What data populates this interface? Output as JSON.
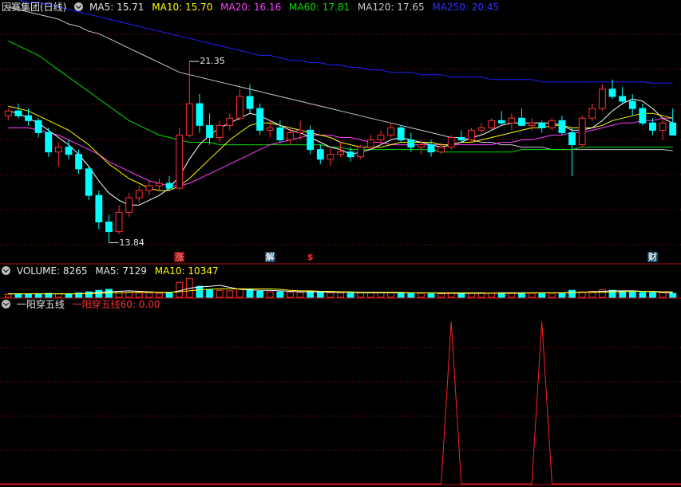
{
  "colors": {
    "background": "#000000",
    "grid": "#7a1010",
    "up": "#ff3030",
    "down": "#00ffff",
    "ma5": "#ffffff",
    "ma10": "#ffff00",
    "ma20": "#ff40ff",
    "ma60": "#00e000",
    "ma120": "#c8c8c8",
    "ma250": "#2020ff",
    "signal": "#ff2020"
  },
  "main_panel": {
    "stock": "因赛集团(日线)",
    "ma5": "MA5: 15.71",
    "ma10": "MA10: 15.70",
    "ma20": "MA20: 16.16",
    "ma60": "MA60: 17.81",
    "ma120": "MA120: 17.65",
    "ma250": "MA250: 20.45",
    "high_label": "21.35",
    "low_label": "13.84"
  },
  "volume_panel": {
    "title": "VOLUME: 8265",
    "ma5": "MA5: 7129",
    "ma10": "MA10: 10347"
  },
  "indicator_panel": {
    "name": "一阳穿五线",
    "value": "一阳穿五线60: 0.00"
  },
  "events": [
    {
      "index": 17,
      "label": "涨",
      "kind": "up"
    },
    {
      "index": 26,
      "label": "解",
      "kind": "down"
    },
    {
      "index": 30,
      "label": "$",
      "kind": "dollar"
    },
    {
      "index": 64,
      "label": "财",
      "kind": "down"
    }
  ],
  "chart_data": {
    "type": "candlestick",
    "ylim": [
      13.0,
      23.3
    ],
    "candles": [
      [
        19.1,
        19.4,
        18.9,
        19.3
      ],
      [
        19.3,
        19.6,
        19.0,
        19.1
      ],
      [
        19.1,
        19.4,
        18.7,
        18.9
      ],
      [
        18.9,
        19.0,
        18.2,
        18.4
      ],
      [
        18.4,
        18.6,
        17.4,
        17.6
      ],
      [
        17.6,
        18.0,
        17.0,
        17.8
      ],
      [
        17.8,
        18.1,
        17.3,
        17.5
      ],
      [
        17.5,
        17.7,
        16.7,
        16.9
      ],
      [
        16.9,
        17.0,
        15.6,
        15.8
      ],
      [
        15.8,
        16.0,
        14.4,
        14.7
      ],
      [
        14.7,
        15.0,
        13.84,
        14.3
      ],
      [
        14.3,
        15.4,
        14.2,
        15.1
      ],
      [
        15.1,
        15.9,
        14.9,
        15.7
      ],
      [
        15.7,
        16.2,
        15.5,
        16.0
      ],
      [
        16.0,
        16.4,
        15.8,
        16.2
      ],
      [
        16.2,
        16.5,
        16.0,
        16.3
      ],
      [
        16.3,
        16.6,
        16.0,
        16.1
      ],
      [
        16.1,
        18.6,
        16.0,
        18.3
      ],
      [
        18.3,
        21.35,
        18.2,
        19.6
      ],
      [
        19.6,
        20.0,
        18.4,
        18.7
      ],
      [
        18.7,
        19.2,
        17.9,
        18.2
      ],
      [
        18.2,
        18.9,
        18.0,
        18.7
      ],
      [
        18.7,
        19.2,
        18.5,
        19.0
      ],
      [
        19.0,
        20.2,
        18.9,
        19.9
      ],
      [
        19.9,
        20.4,
        19.2,
        19.4
      ],
      [
        19.4,
        19.6,
        18.3,
        18.5
      ],
      [
        18.5,
        18.9,
        18.2,
        18.6
      ],
      [
        18.6,
        18.9,
        18.0,
        18.1
      ],
      [
        18.1,
        18.6,
        17.9,
        18.4
      ],
      [
        18.4,
        18.9,
        18.1,
        18.5
      ],
      [
        18.5,
        18.7,
        17.5,
        17.7
      ],
      [
        17.7,
        17.9,
        17.1,
        17.3
      ],
      [
        17.3,
        17.8,
        17.0,
        17.5
      ],
      [
        17.5,
        18.0,
        17.4,
        17.6
      ],
      [
        17.6,
        17.8,
        17.2,
        17.4
      ],
      [
        17.4,
        17.9,
        17.3,
        17.8
      ],
      [
        17.8,
        18.3,
        17.7,
        18.1
      ],
      [
        18.1,
        18.5,
        17.9,
        18.3
      ],
      [
        18.3,
        18.8,
        18.2,
        18.6
      ],
      [
        18.6,
        18.7,
        18.0,
        18.1
      ],
      [
        18.1,
        18.4,
        17.6,
        17.8
      ],
      [
        17.8,
        18.1,
        17.5,
        17.9
      ],
      [
        17.9,
        18.1,
        17.4,
        17.6
      ],
      [
        17.6,
        18.0,
        17.5,
        17.8
      ],
      [
        17.8,
        18.3,
        17.7,
        18.2
      ],
      [
        18.2,
        18.5,
        18.0,
        18.1
      ],
      [
        18.1,
        18.6,
        18.0,
        18.5
      ],
      [
        18.5,
        18.8,
        18.3,
        18.6
      ],
      [
        18.6,
        19.0,
        18.5,
        18.9
      ],
      [
        18.9,
        19.3,
        18.7,
        18.8
      ],
      [
        18.8,
        19.2,
        18.5,
        19.0
      ],
      [
        19.0,
        19.4,
        18.9,
        18.7
      ],
      [
        18.7,
        19.0,
        18.5,
        18.8
      ],
      [
        18.8,
        18.9,
        18.4,
        18.6
      ],
      [
        18.6,
        19.0,
        18.5,
        18.9
      ],
      [
        18.9,
        19.1,
        18.3,
        18.4
      ],
      [
        18.4,
        18.6,
        16.6,
        17.9
      ],
      [
        17.9,
        19.1,
        17.8,
        19.0
      ],
      [
        19.0,
        19.6,
        18.9,
        19.4
      ],
      [
        19.4,
        20.4,
        19.3,
        20.2
      ],
      [
        20.2,
        20.6,
        19.8,
        19.9
      ],
      [
        19.9,
        20.3,
        19.6,
        19.7
      ],
      [
        19.7,
        20.0,
        19.1,
        19.4
      ],
      [
        19.4,
        19.6,
        18.7,
        18.8
      ],
      [
        18.8,
        19.0,
        18.3,
        18.5
      ],
      [
        18.5,
        19.0,
        18.1,
        18.8
      ],
      [
        18.8,
        19.4,
        18.5,
        18.3
      ]
    ],
    "ma5": [
      19.3,
      19.2,
      19.0,
      18.8,
      18.5,
      18.2,
      17.9,
      17.5,
      17.0,
      16.4,
      15.9,
      15.6,
      15.4,
      15.4,
      15.6,
      15.8,
      16.1,
      16.6,
      17.3,
      17.9,
      18.3,
      18.6,
      18.8,
      19.0,
      19.2,
      19.1,
      18.9,
      18.7,
      18.5,
      18.4,
      18.2,
      18.0,
      17.8,
      17.7,
      17.5,
      17.6,
      17.7,
      17.9,
      18.1,
      18.2,
      18.1,
      18.0,
      17.9,
      17.8,
      17.9,
      18.0,
      18.2,
      18.3,
      18.5,
      18.7,
      18.8,
      18.8,
      18.8,
      18.8,
      18.8,
      18.7,
      18.5,
      18.5,
      18.6,
      18.9,
      19.3,
      19.6,
      19.8,
      19.7,
      19.4,
      19.0,
      18.8
    ],
    "ma10": [
      19.5,
      19.4,
      19.3,
      19.1,
      18.9,
      18.7,
      18.5,
      18.2,
      17.9,
      17.5,
      17.1,
      16.8,
      16.5,
      16.3,
      16.1,
      16.0,
      16.0,
      16.2,
      16.5,
      16.9,
      17.3,
      17.7,
      18.1,
      18.4,
      18.7,
      18.8,
      18.8,
      18.7,
      18.6,
      18.5,
      18.4,
      18.3,
      18.2,
      18.0,
      17.9,
      17.8,
      17.8,
      17.8,
      17.9,
      18.0,
      18.0,
      18.0,
      18.0,
      17.9,
      17.9,
      18.0,
      18.0,
      18.1,
      18.2,
      18.3,
      18.4,
      18.5,
      18.6,
      18.6,
      18.7,
      18.7,
      18.6,
      18.6,
      18.6,
      18.7,
      18.9,
      19.0,
      19.1,
      19.2,
      19.2,
      19.1,
      19.0
    ],
    "ma20": [
      18.6,
      18.6,
      18.6,
      18.5,
      18.4,
      18.3,
      18.1,
      17.9,
      17.7,
      17.5,
      17.2,
      17.0,
      16.8,
      16.6,
      16.4,
      16.3,
      16.2,
      16.2,
      16.3,
      16.5,
      16.7,
      16.9,
      17.1,
      17.3,
      17.5,
      17.7,
      17.9,
      18.0,
      18.1,
      18.2,
      18.3,
      18.3,
      18.3,
      18.2,
      18.2,
      18.1,
      18.0,
      18.0,
      17.9,
      17.9,
      17.9,
      17.9,
      17.9,
      17.9,
      17.9,
      17.9,
      17.9,
      17.9,
      17.9,
      18.0,
      18.0,
      18.1,
      18.1,
      18.2,
      18.3,
      18.3,
      18.4,
      18.4,
      18.5,
      18.6,
      18.7,
      18.8,
      18.8,
      18.9,
      18.9,
      19.0,
      19.0
    ],
    "ma60": [
      22.2,
      22.0,
      21.8,
      21.6,
      21.3,
      21.0,
      20.7,
      20.4,
      20.1,
      19.8,
      19.5,
      19.2,
      18.9,
      18.7,
      18.5,
      18.3,
      18.2,
      18.1,
      18.0,
      18.0,
      18.0,
      17.9,
      17.9,
      17.9,
      17.9,
      17.9,
      17.9,
      17.9,
      17.9,
      17.9,
      17.9,
      17.9,
      17.8,
      17.8,
      17.7,
      17.7,
      17.7,
      17.7,
      17.7,
      17.7,
      17.7,
      17.7,
      17.7,
      17.6,
      17.6,
      17.6,
      17.6,
      17.6,
      17.6,
      17.6,
      17.6,
      17.7,
      17.7,
      17.7,
      17.7,
      17.7,
      17.7,
      17.8,
      17.8,
      17.8,
      17.8,
      17.8,
      17.8,
      17.8,
      17.8,
      17.8,
      17.8
    ],
    "ma120": [
      23.6,
      23.5,
      23.4,
      23.3,
      23.2,
      23.1,
      22.9,
      22.8,
      22.6,
      22.5,
      22.3,
      22.1,
      21.9,
      21.7,
      21.5,
      21.3,
      21.1,
      20.9,
      20.8,
      20.7,
      20.6,
      20.5,
      20.4,
      20.3,
      20.2,
      20.1,
      20.0,
      19.9,
      19.8,
      19.7,
      19.6,
      19.5,
      19.4,
      19.3,
      19.2,
      19.1,
      19.0,
      18.9,
      18.8,
      18.7,
      18.6,
      18.5,
      18.4,
      18.3,
      18.2,
      18.2,
      18.1,
      18.0,
      18.0,
      17.9,
      17.9,
      17.8,
      17.8,
      17.8,
      17.7,
      17.7,
      17.7,
      17.7,
      17.7,
      17.7,
      17.7,
      17.7,
      17.7,
      17.7,
      17.7,
      17.7,
      17.65
    ],
    "ma250": [
      24.0,
      23.9,
      23.8,
      23.8,
      23.7,
      23.6,
      23.5,
      23.4,
      23.3,
      23.2,
      23.1,
      23.0,
      22.9,
      22.8,
      22.7,
      22.6,
      22.5,
      22.4,
      22.3,
      22.2,
      22.1,
      22.0,
      21.9,
      21.8,
      21.7,
      21.6,
      21.6,
      21.5,
      21.4,
      21.4,
      21.3,
      21.3,
      21.2,
      21.2,
      21.1,
      21.1,
      21.0,
      21.0,
      20.9,
      20.9,
      20.9,
      20.8,
      20.8,
      20.8,
      20.7,
      20.7,
      20.7,
      20.7,
      20.6,
      20.6,
      20.6,
      20.6,
      20.6,
      20.5,
      20.5,
      20.5,
      20.5,
      20.5,
      20.5,
      20.5,
      20.5,
      20.5,
      20.5,
      20.5,
      20.45,
      20.45,
      20.45
    ],
    "volume": [
      6,
      7,
      6,
      7,
      8,
      7,
      6,
      9,
      11,
      14,
      16,
      12,
      10,
      9,
      9,
      8,
      8,
      30,
      38,
      22,
      16,
      14,
      13,
      17,
      15,
      12,
      11,
      11,
      10,
      10,
      12,
      11,
      9,
      9,
      8,
      9,
      9,
      10,
      10,
      9,
      8,
      8,
      7,
      7,
      8,
      8,
      8,
      9,
      9,
      9,
      9,
      9,
      8,
      8,
      8,
      9,
      14,
      11,
      12,
      15,
      14,
      12,
      11,
      10,
      9,
      9,
      8
    ],
    "vol_ma5": [
      7,
      7,
      7,
      7,
      7,
      7,
      7,
      7,
      8,
      10,
      11,
      12,
      13,
      12,
      11,
      10,
      9,
      13,
      18,
      21,
      22,
      24,
      20,
      16,
      15,
      14,
      14,
      13,
      12,
      11,
      11,
      11,
      10,
      10,
      10,
      9,
      9,
      9,
      9,
      9,
      9,
      9,
      9,
      8,
      8,
      8,
      8,
      8,
      8,
      9,
      9,
      9,
      9,
      9,
      9,
      9,
      10,
      10,
      11,
      12,
      13,
      13,
      13,
      12,
      11,
      10,
      9
    ],
    "vol_ma10": [
      7,
      7,
      7,
      7,
      7,
      7,
      7,
      7,
      7,
      8,
      9,
      9,
      10,
      10,
      10,
      10,
      10,
      11,
      13,
      15,
      16,
      17,
      17,
      17,
      17,
      17,
      17,
      16,
      14,
      13,
      13,
      12,
      12,
      11,
      11,
      10,
      10,
      10,
      10,
      10,
      9,
      9,
      9,
      9,
      9,
      9,
      9,
      9,
      8,
      8,
      8,
      8,
      9,
      9,
      9,
      9,
      9,
      10,
      10,
      10,
      11,
      11,
      12,
      12,
      12,
      11,
      11
    ],
    "signal_peaks": [
      {
        "index": 44,
        "value": 60
      },
      {
        "index": 53,
        "value": 60
      }
    ],
    "signal_ylim": [
      0,
      64
    ]
  }
}
